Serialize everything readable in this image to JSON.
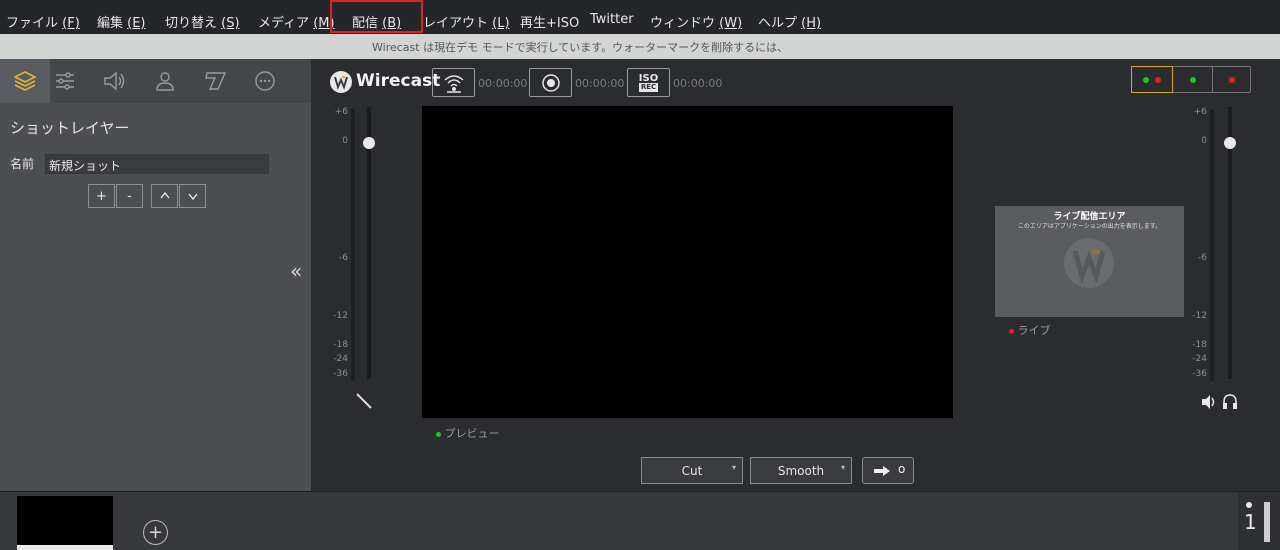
{
  "window": {
    "title": ""
  },
  "menu": [
    {
      "label": "ファイル ",
      "key": "(F)"
    },
    {
      "label": "編集 ",
      "key": "(E)"
    },
    {
      "label": "切り替え ",
      "key": "(S)"
    },
    {
      "label": "メディア ",
      "key": "(M)"
    },
    {
      "label": "配信 ",
      "key": "(B)"
    },
    {
      "label": "レイアウト ",
      "key": "(L)"
    },
    {
      "label": "再生+ISO",
      "key": ""
    },
    {
      "label": "Twitter",
      "key": ""
    },
    {
      "label": "ウィンドウ ",
      "key": "(W)"
    },
    {
      "label": "ヘルプ ",
      "key": "(H)"
    }
  ],
  "banner": {
    "text": "Wirecast は現在デモ モードで実行しています。ウォーターマークを削除するには、"
  },
  "left_panel": {
    "tabs": [
      "layers-icon",
      "sliders-icon",
      "speaker-icon",
      "person-icon",
      "title-icon",
      "more-icon"
    ],
    "title": "ショットレイヤー",
    "name_label": "名前",
    "name_value": "新規ショット",
    "buttons": {
      "add": "+",
      "remove": "-",
      "up": "^",
      "down": "v"
    },
    "collapse": "«"
  },
  "toolbar": {
    "logo": "Wirecast",
    "stream_time": "00:00:00",
    "record_time": "00:00:00",
    "iso_time": "00:00:00",
    "iso_label": "ISO",
    "iso_sub": "REC",
    "colors": {
      "green": "#21c521",
      "red": "#e0241b",
      "active_border": "#d6a81f"
    }
  },
  "meter_labels": [
    "+6",
    "0",
    "-6",
    "-12",
    "-18",
    "-24",
    "-36"
  ],
  "preview": {
    "label": "プレビュー"
  },
  "live": {
    "label": "ライブ",
    "title": "ライブ配信エリア",
    "subtitle": "このエリアはアプリケーションの出力を表示します。"
  },
  "transitions": {
    "cut": "Cut",
    "smooth": "Smooth",
    "go": "o"
  },
  "bottom": {
    "layer_number": "1"
  }
}
